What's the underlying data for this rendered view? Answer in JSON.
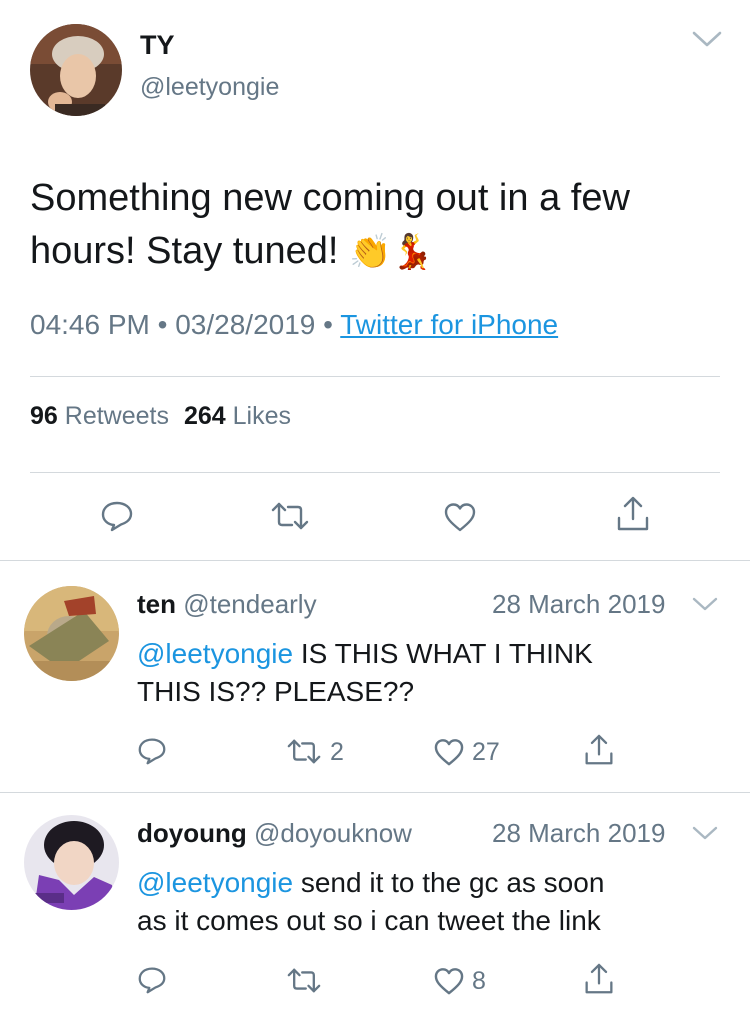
{
  "tweet": {
    "display_name": "TY",
    "handle": "@leetyongie",
    "text": "Something new coming out in a few hours! Stay tuned!",
    "emojis": "👏💃",
    "time": "04:46 PM",
    "date": "03/28/2019",
    "separator": "•",
    "source": "Twitter for iPhone",
    "retweet_count": "96",
    "retweet_label": "Retweets",
    "like_count": "264",
    "like_label": "Likes"
  },
  "replies": [
    {
      "display_name": "ten",
      "handle": "@tendearly",
      "date": "28 March 2019",
      "mention": "@leetyongie",
      "text_line1": " IS THIS WHAT I THINK",
      "text_line2": "THIS IS?? PLEASE??",
      "retweet_count": "2",
      "like_count": "27"
    },
    {
      "display_name": "doyoung",
      "handle": "@doyouknow",
      "date": "28 March 2019",
      "mention": "@leetyongie",
      "text_line1": " send it to the gc as soon",
      "text_line2": "as it comes out so i can tweet the link",
      "retweet_count": "",
      "like_count": "8"
    }
  ],
  "colors": {
    "link": "#1b95e0",
    "secondary": "#657786",
    "divider": "#d4d9dd"
  },
  "icons": [
    "reply-icon",
    "retweet-icon",
    "like-icon",
    "share-icon",
    "chevron-down-icon"
  ]
}
